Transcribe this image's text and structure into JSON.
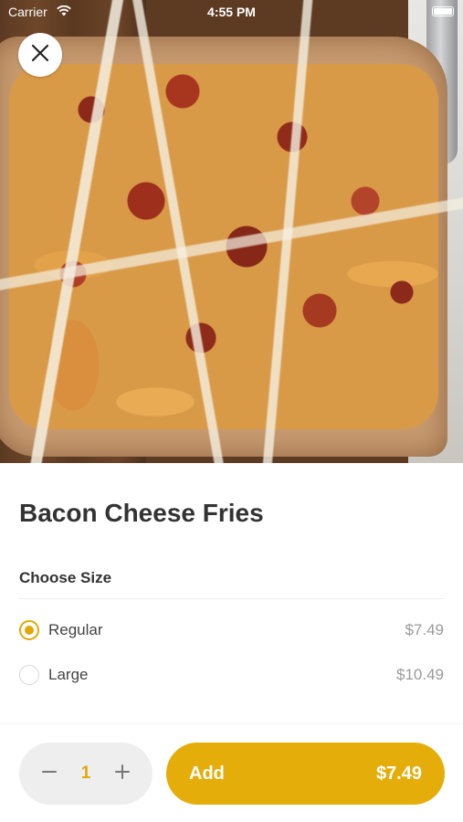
{
  "status_bar": {
    "carrier": "Carrier",
    "time": "4:55 PM"
  },
  "item": {
    "title": "Bacon Cheese Fries"
  },
  "size_section": {
    "label": "Choose Size",
    "options": [
      {
        "label": "Regular",
        "price": "$7.49",
        "selected": true
      },
      {
        "label": "Large",
        "price": "$10.49",
        "selected": false
      }
    ]
  },
  "footer": {
    "quantity": "1",
    "add_label": "Add",
    "add_price": "$7.49"
  },
  "colors": {
    "accent": "#e5ad0a",
    "text": "#333333",
    "muted": "#9b9b9b"
  },
  "icons": {
    "close": "close-icon",
    "minus": "minus-icon",
    "plus": "plus-icon",
    "wifi": "wifi-icon",
    "battery": "battery-icon"
  }
}
